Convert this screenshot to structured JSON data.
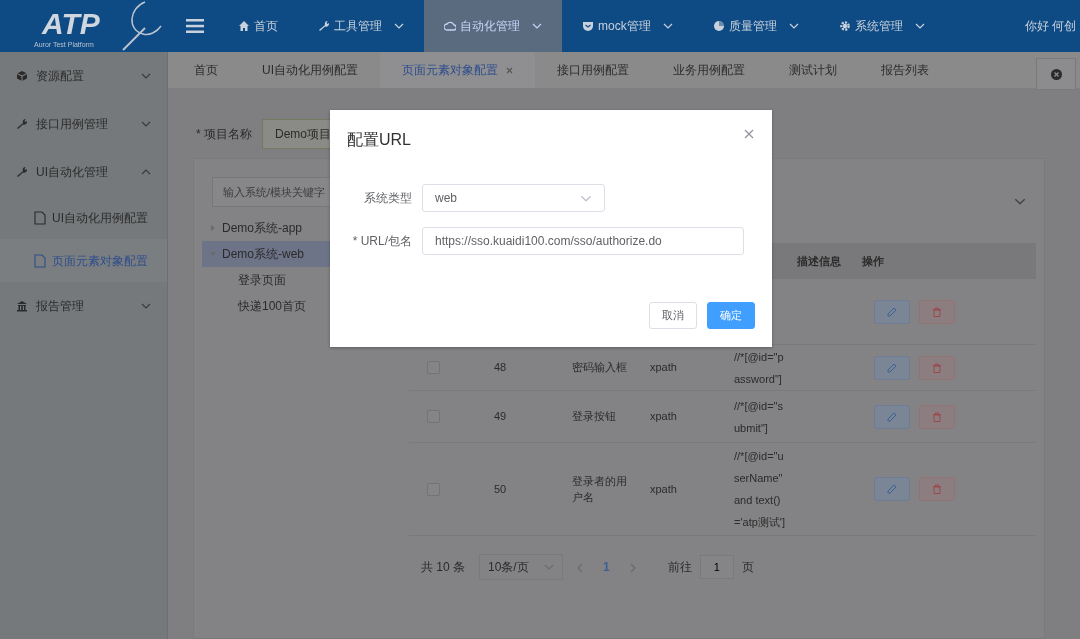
{
  "header": {
    "logo": "ATP",
    "logo_subtitle": "Auror Test Platform",
    "nav": [
      {
        "label": "首页",
        "dropdown": false,
        "selected": false
      },
      {
        "label": "工具管理",
        "dropdown": true,
        "selected": false
      },
      {
        "label": "自动化管理",
        "dropdown": true,
        "selected": true
      },
      {
        "label": "mock管理",
        "dropdown": true,
        "selected": false
      },
      {
        "label": "质量管理",
        "dropdown": true,
        "selected": false
      },
      {
        "label": "系统管理",
        "dropdown": true,
        "selected": false
      }
    ],
    "user": "你好 何创"
  },
  "sidebar": {
    "items": [
      {
        "label": "资源配置",
        "expanded": false
      },
      {
        "label": "接口用例管理",
        "expanded": false
      },
      {
        "label": "UI自动化管理",
        "expanded": true,
        "children": [
          {
            "label": "UI自动化用例配置",
            "selected": false
          },
          {
            "label": "页面元素对象配置",
            "selected": true
          }
        ]
      },
      {
        "label": "报告管理",
        "expanded": false
      }
    ]
  },
  "tabs": [
    {
      "label": "首页",
      "selected": false
    },
    {
      "label": "UI自动化用例配置",
      "selected": false
    },
    {
      "label": "页面元素对象配置",
      "selected": true
    },
    {
      "label": "接口用例配置",
      "selected": false
    },
    {
      "label": "业务用例配置",
      "selected": false
    },
    {
      "label": "测试计划",
      "selected": false
    },
    {
      "label": "报告列表",
      "selected": false
    }
  ],
  "filter": {
    "label": "* 项目名称",
    "value": "Demo项目"
  },
  "tree": {
    "placeholder": "输入系统/模块关键字",
    "nodes": [
      {
        "label": "Demo系统-app",
        "expanded": false,
        "selected": false
      },
      {
        "label": "Demo系统-web",
        "expanded": true,
        "selected": true,
        "children": [
          {
            "label": "登录页面"
          },
          {
            "label": "快递100首页"
          }
        ]
      }
    ]
  },
  "table": {
    "columns": [
      "描述信息",
      "操作"
    ],
    "rows": [
      {},
      {
        "checked": false,
        "id": "48",
        "name": "密码输入框",
        "type": "xpath",
        "locator": "//*[@id=\"password\"]"
      },
      {
        "checked": false,
        "id": "49",
        "name": "登录按钮",
        "type": "xpath",
        "locator": "//*[@id=\"submit\"]"
      },
      {
        "checked": false,
        "id": "50",
        "name": "登录者的用户名",
        "type": "xpath",
        "locator": "//*[@id=\"userName\" and text()='atp测试']"
      }
    ]
  },
  "pagination": {
    "total": "共 10 条",
    "page_size": "10条/页",
    "pages": [
      {
        "label": "1",
        "selected": true
      }
    ],
    "goto_label": "前往",
    "goto_value": "1",
    "goto_suffix": "页"
  },
  "dialog": {
    "title": "配置URL",
    "fields": [
      {
        "label": "系统类型",
        "kind": "select",
        "value": "web"
      },
      {
        "label": "* URL/包名",
        "kind": "text",
        "value": "https://sso.kuaidi100.com/sso/authorize.do"
      }
    ],
    "buttons": [
      {
        "label": "取消",
        "primary": false
      },
      {
        "label": "确定",
        "primary": true
      }
    ]
  }
}
